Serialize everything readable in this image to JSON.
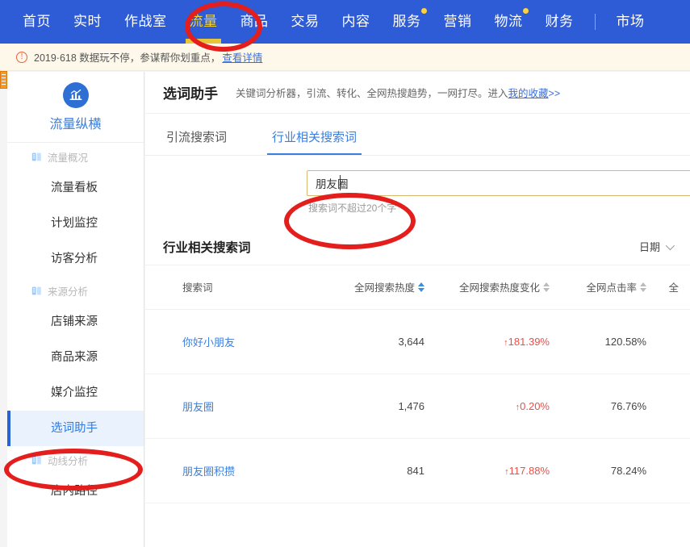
{
  "topnav": {
    "items": [
      {
        "label": "首页",
        "active": false,
        "badge": false
      },
      {
        "label": "实时",
        "active": false,
        "badge": false
      },
      {
        "label": "作战室",
        "active": false,
        "badge": false
      },
      {
        "label": "流量",
        "active": true,
        "badge": false
      },
      {
        "label": "商品",
        "active": false,
        "badge": false
      },
      {
        "label": "交易",
        "active": false,
        "badge": false
      },
      {
        "label": "内容",
        "active": false,
        "badge": false
      },
      {
        "label": "服务",
        "active": false,
        "badge": true
      },
      {
        "label": "营销",
        "active": false,
        "badge": false
      },
      {
        "label": "物流",
        "active": false,
        "badge": true
      },
      {
        "label": "财务",
        "active": false,
        "badge": false
      },
      {
        "label": "市场",
        "active": false,
        "badge": false
      }
    ],
    "active_color": "#f2d23c",
    "bg_color": "#2e5bd6",
    "badge_color": "#ffd43b"
  },
  "notice": {
    "icon": "exclamation-circle-icon",
    "text": "2019·618 数据玩不停，参谋帮你划重点，",
    "link": "查看详情",
    "bg_color": "#fdf8e9"
  },
  "sidebar": {
    "logo_icon": "chart-pillar-icon",
    "title": "流量纵横",
    "title_color": "#3d7ddb",
    "sections": [
      {
        "group": "流量概况",
        "group_icon": "report-icon",
        "items": [
          {
            "label": "流量看板",
            "active": false
          },
          {
            "label": "计划监控",
            "active": false
          },
          {
            "label": "访客分析",
            "active": false
          }
        ]
      },
      {
        "group": "来源分析",
        "group_icon": "report-icon",
        "items": [
          {
            "label": "店铺来源",
            "active": false
          },
          {
            "label": "商品来源",
            "active": false
          },
          {
            "label": "媒介监控",
            "active": false
          },
          {
            "label": "选词助手",
            "active": true
          }
        ]
      },
      {
        "group": "动线分析",
        "group_icon": "report-icon",
        "items": [
          {
            "label": "店内路径",
            "active": false
          }
        ]
      }
    ],
    "active_bg": "#e9f2fd",
    "active_border": "#2563d6"
  },
  "main": {
    "title": "选词助手",
    "subtitle_before": "关键词分析器，引流、转化、全网热搜趋势，一网打尽。进入",
    "subtitle_link": "我的收藏",
    "subtitle_after": ">>",
    "tabs": [
      {
        "label": "引流搜索词",
        "active": false
      },
      {
        "label": "行业相关搜索词",
        "active": true
      }
    ],
    "search": {
      "value": "朋友圈",
      "placeholder": "",
      "hint": "搜索词不超过20个字",
      "border_color": "#d8b871"
    },
    "section": {
      "title": "行业相关搜索词",
      "date_label": "日期",
      "date_icon": "chevron-down-icon"
    },
    "table": {
      "columns": [
        {
          "label": "搜索词",
          "sortable": false,
          "sorted": null
        },
        {
          "label": "全网搜索热度",
          "sortable": true,
          "sorted": "desc"
        },
        {
          "label": "全网搜索热度变化",
          "sortable": true,
          "sorted": null
        },
        {
          "label": "全网点击率",
          "sortable": true,
          "sorted": null
        },
        {
          "label": "全",
          "sortable": true,
          "sorted": null
        }
      ],
      "rows": [
        {
          "keyword": "你好小朋友",
          "heat": "3,644",
          "change": "181.39%",
          "change_dir": "up",
          "ctr": "120.58%"
        },
        {
          "keyword": "朋友圈",
          "heat": "1,476",
          "change": "0.20%",
          "change_dir": "up",
          "ctr": "76.76%"
        },
        {
          "keyword": "朋友圈积攒",
          "heat": "841",
          "change": "117.88%",
          "change_dir": "up",
          "ctr": "78.24%"
        }
      ],
      "up_arrow": "↑",
      "trend_up_color": "#e8504a"
    }
  },
  "annotations": {
    "color": "#e41d1d",
    "shapes": [
      {
        "name": "annotation-circle-nav-traffic",
        "target": "流量"
      },
      {
        "name": "annotation-circle-search-input",
        "target": "朋友圈"
      },
      {
        "name": "annotation-circle-sidebar-keyword-helper",
        "target": "选词助手"
      }
    ]
  }
}
